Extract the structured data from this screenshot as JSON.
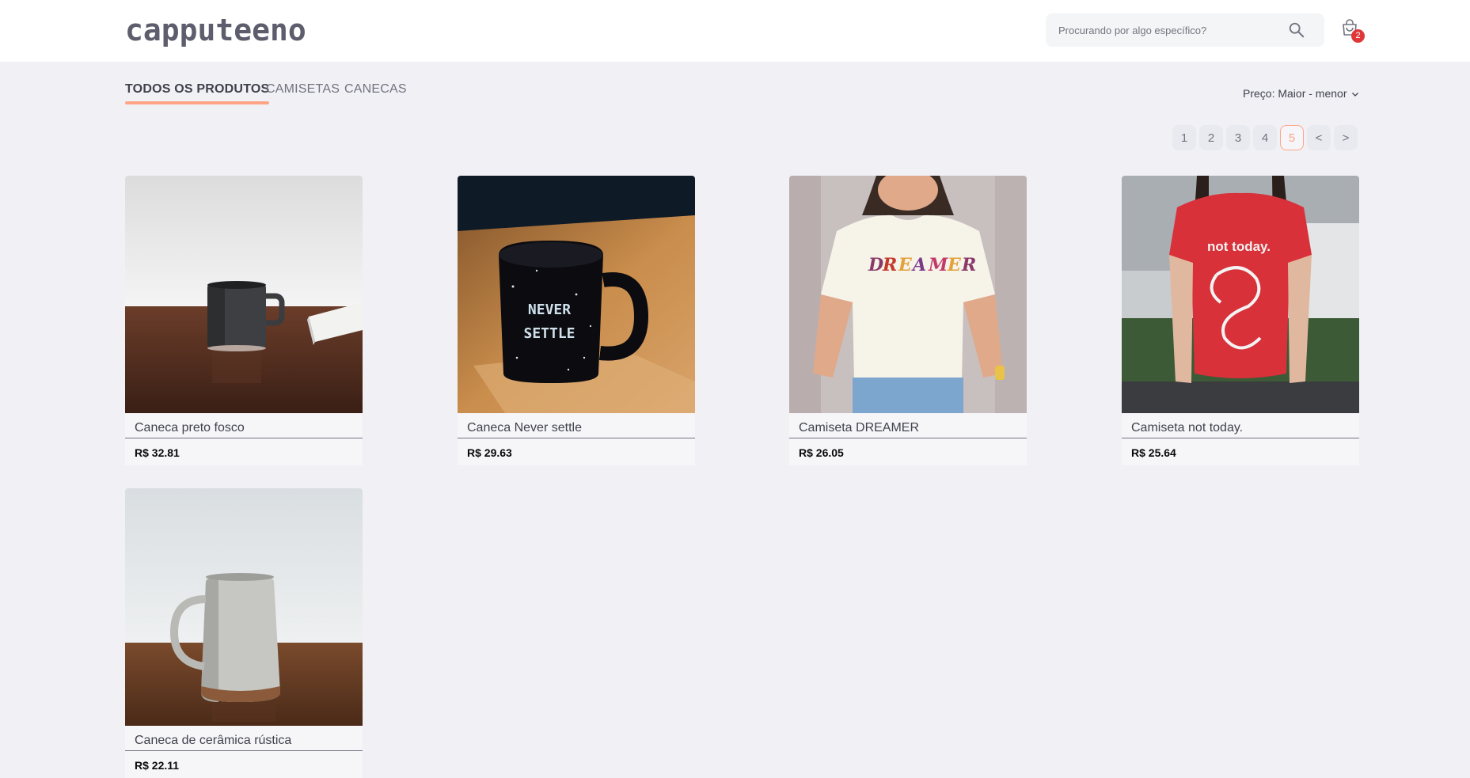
{
  "header": {
    "logo": "capputeeno",
    "search": {
      "placeholder": "Procurando por algo específico?",
      "icon": "search-icon"
    },
    "cart": {
      "icon": "shopping-bag-icon",
      "count": "2"
    }
  },
  "filters": {
    "tabs": [
      {
        "label": "TODOS OS PRODUTOS",
        "active": true
      },
      {
        "label": "CAMISETAS",
        "active": false
      },
      {
        "label": "CANECAS",
        "active": false
      }
    ],
    "sort": {
      "label": "Preço: Maior - menor",
      "icon": "chevron-down-icon"
    }
  },
  "pagination": {
    "pages": [
      "1",
      "2",
      "3",
      "4",
      "5"
    ],
    "current": "5",
    "prev": "<",
    "next": ">"
  },
  "colors": {
    "accent": "#FFA585",
    "badge": "#DE3838",
    "background": "#F0F0F5"
  },
  "products": [
    {
      "name": "Caneca preto fosco",
      "price": "R$ 32.81"
    },
    {
      "name": "Caneca Never settle",
      "price": "R$ 29.63",
      "image_text": "NEVER SETTLE"
    },
    {
      "name": "Camiseta DREAMER",
      "price": "R$ 26.05",
      "image_text": "DREAMER"
    },
    {
      "name": "Camiseta not today.",
      "price": "R$ 25.64",
      "image_text": "not today."
    },
    {
      "name": "Caneca de cerâmica rústica",
      "price": "R$ 22.11"
    }
  ]
}
